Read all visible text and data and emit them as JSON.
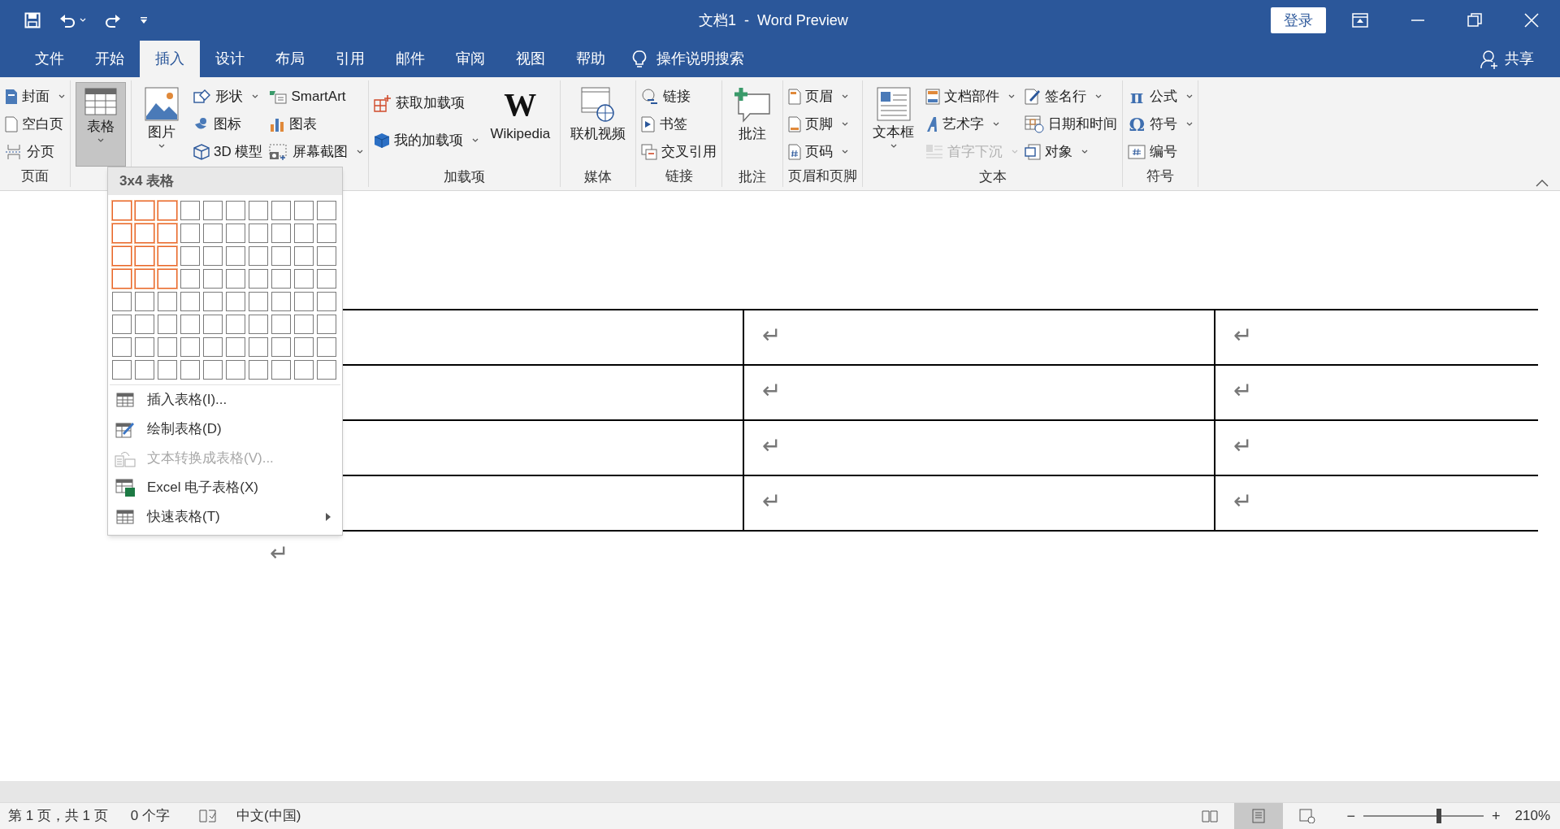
{
  "title_bar": {
    "title": "文档1  -  Word Preview",
    "login": "登录"
  },
  "tabs": [
    {
      "label": "文件",
      "selected": false
    },
    {
      "label": "开始",
      "selected": false
    },
    {
      "label": "插入",
      "selected": true
    },
    {
      "label": "设计",
      "selected": false
    },
    {
      "label": "布局",
      "selected": false
    },
    {
      "label": "引用",
      "selected": false
    },
    {
      "label": "邮件",
      "selected": false
    },
    {
      "label": "审阅",
      "selected": false
    },
    {
      "label": "视图",
      "selected": false
    },
    {
      "label": "帮助",
      "selected": false
    }
  ],
  "search": {
    "label": "操作说明搜索"
  },
  "share": "共享",
  "ribbon": [
    {
      "label": "页面",
      "columns": [
        {
          "kind": "small",
          "items": [
            {
              "label": "封面",
              "dropdown": true
            },
            {
              "label": "空白页"
            },
            {
              "label": "分页"
            }
          ]
        }
      ]
    },
    {
      "columns": [
        {
          "kind": "large",
          "items": [
            {
              "label": "表格",
              "dropdown": true,
              "pressed": true
            }
          ]
        }
      ]
    },
    {
      "columns": [
        {
          "kind": "large",
          "items": [
            {
              "label": "图片",
              "dropdown": true
            }
          ]
        },
        {
          "kind": "small",
          "items": [
            {
              "label": "形状",
              "dropdown": true
            },
            {
              "label": "图标"
            },
            {
              "label": "3D 模型"
            }
          ]
        },
        {
          "kind": "small",
          "items": [
            {
              "label": "SmartArt"
            },
            {
              "label": "图表"
            },
            {
              "label": "屏幕截图",
              "dropdown": true
            }
          ]
        }
      ]
    },
    {
      "label": "加载项",
      "columns": [
        {
          "kind": "pair",
          "items": [
            {
              "label": "获取加载项"
            },
            {
              "label": "我的加载项",
              "dropdown": true
            }
          ]
        },
        {
          "kind": "large",
          "items": [
            {
              "label": "Wikipedia",
              "logo_text": "W"
            }
          ]
        }
      ]
    },
    {
      "label": "媒体",
      "columns": [
        {
          "kind": "large",
          "items": [
            {
              "label": "联机视频"
            }
          ]
        }
      ]
    },
    {
      "label": "链接",
      "columns": [
        {
          "kind": "small",
          "items": [
            {
              "label": "链接"
            },
            {
              "label": "书签"
            },
            {
              "label": "交叉引用"
            }
          ]
        }
      ]
    },
    {
      "label": "批注",
      "columns": [
        {
          "kind": "large",
          "items": [
            {
              "label": "批注"
            }
          ]
        }
      ]
    },
    {
      "label": "页眉和页脚",
      "columns": [
        {
          "kind": "small",
          "items": [
            {
              "label": "页眉",
              "dropdown": true
            },
            {
              "label": "页脚",
              "dropdown": true
            },
            {
              "label": "页码",
              "dropdown": true
            }
          ]
        }
      ]
    },
    {
      "label": "文本",
      "columns": [
        {
          "kind": "large",
          "items": [
            {
              "label": "文本框",
              "dropdown": true
            }
          ]
        },
        {
          "kind": "small",
          "items": [
            {
              "label": "文档部件",
              "dropdown": true
            },
            {
              "label": "艺术字",
              "dropdown": true
            },
            {
              "label": "首字下沉",
              "dropdown": true,
              "disabled": true
            }
          ]
        },
        {
          "kind": "small",
          "items": [
            {
              "label": "签名行",
              "dropdown": true
            },
            {
              "label": "日期和时间"
            },
            {
              "label": "对象",
              "dropdown": true
            }
          ]
        }
      ]
    },
    {
      "label": "符号",
      "columns": [
        {
          "kind": "small",
          "items": [
            {
              "label": "公式",
              "dropdown": true,
              "symbol": "π"
            },
            {
              "label": "符号",
              "dropdown": true,
              "symbol": "Ω"
            },
            {
              "label": "编号"
            }
          ]
        }
      ]
    }
  ],
  "table_menu": {
    "header": "3x4 表格",
    "grid_rows": [
      {
        "cells": [
          {
            "selected": true
          },
          {
            "selected": true
          },
          {
            "selected": true
          },
          {
            "selected": false
          },
          {
            "selected": false
          },
          {
            "selected": false
          },
          {
            "selected": false
          },
          {
            "selected": false
          },
          {
            "selected": false
          },
          {
            "selected": false
          }
        ]
      },
      {
        "cells": [
          {
            "selected": true
          },
          {
            "selected": true
          },
          {
            "selected": true
          },
          {
            "selected": false
          },
          {
            "selected": false
          },
          {
            "selected": false
          },
          {
            "selected": false
          },
          {
            "selected": false
          },
          {
            "selected": false
          },
          {
            "selected": false
          }
        ]
      },
      {
        "cells": [
          {
            "selected": true
          },
          {
            "selected": true
          },
          {
            "selected": true
          },
          {
            "selected": false
          },
          {
            "selected": false
          },
          {
            "selected": false
          },
          {
            "selected": false
          },
          {
            "selected": false
          },
          {
            "selected": false
          },
          {
            "selected": false
          }
        ]
      },
      {
        "cells": [
          {
            "selected": true
          },
          {
            "selected": true
          },
          {
            "selected": true
          },
          {
            "selected": false
          },
          {
            "selected": false
          },
          {
            "selected": false
          },
          {
            "selected": false
          },
          {
            "selected": false
          },
          {
            "selected": false
          },
          {
            "selected": false
          }
        ]
      },
      {
        "cells": [
          {
            "selected": false
          },
          {
            "selected": false
          },
          {
            "selected": false
          },
          {
            "selected": false
          },
          {
            "selected": false
          },
          {
            "selected": false
          },
          {
            "selected": false
          },
          {
            "selected": false
          },
          {
            "selected": false
          },
          {
            "selected": false
          }
        ]
      },
      {
        "cells": [
          {
            "selected": false
          },
          {
            "selected": false
          },
          {
            "selected": false
          },
          {
            "selected": false
          },
          {
            "selected": false
          },
          {
            "selected": false
          },
          {
            "selected": false
          },
          {
            "selected": false
          },
          {
            "selected": false
          },
          {
            "selected": false
          }
        ]
      },
      {
        "cells": [
          {
            "selected": false
          },
          {
            "selected": false
          },
          {
            "selected": false
          },
          {
            "selected": false
          },
          {
            "selected": false
          },
          {
            "selected": false
          },
          {
            "selected": false
          },
          {
            "selected": false
          },
          {
            "selected": false
          },
          {
            "selected": false
          }
        ]
      },
      {
        "cells": [
          {
            "selected": false
          },
          {
            "selected": false
          },
          {
            "selected": false
          },
          {
            "selected": false
          },
          {
            "selected": false
          },
          {
            "selected": false
          },
          {
            "selected": false
          },
          {
            "selected": false
          },
          {
            "selected": false
          },
          {
            "selected": false
          }
        ]
      }
    ],
    "items": [
      {
        "label": "插入表格(I)...",
        "disabled": false,
        "submenu": false
      },
      {
        "label": "绘制表格(D)",
        "disabled": false,
        "submenu": false
      },
      {
        "label": "文本转换成表格(V)...",
        "disabled": true,
        "submenu": false
      },
      {
        "label": "Excel 电子表格(X)",
        "disabled": false,
        "submenu": false
      },
      {
        "label": "快速表格(T)",
        "disabled": false,
        "submenu": true
      }
    ]
  },
  "document": {
    "table_rows": [
      {
        "cells": [
          "↵",
          "↵"
        ]
      },
      {
        "cells": [
          "↵",
          "↵"
        ]
      },
      {
        "cells": [
          "↵",
          "↵"
        ]
      },
      {
        "cells": [
          "↵",
          "↵"
        ]
      }
    ],
    "after_table": "↵"
  },
  "status_bar": {
    "page": "第 1 页，共 1 页",
    "words": "0 个字",
    "language": "中文(中国)",
    "views": [
      {
        "selected": false
      },
      {
        "selected": true
      },
      {
        "selected": false
      }
    ],
    "zoom": {
      "minus": "−",
      "plus": "+",
      "level": 0.63,
      "reading": "210%"
    }
  }
}
